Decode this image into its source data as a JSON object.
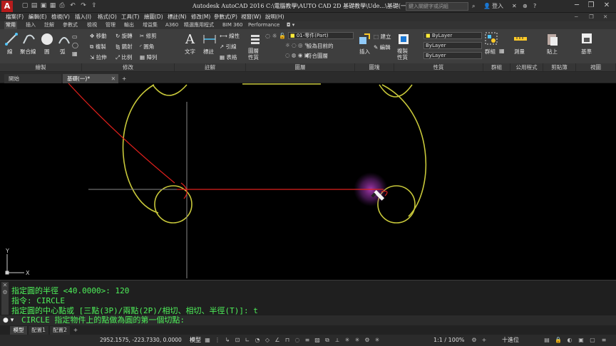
{
  "title_bar": {
    "title": "Autodesk AutoCAD 2016    C:\\電腦教學\\AUTO CAD 2D 基礎教學\\Ude...\\基礎(一).dwg",
    "search_placeholder": "鍵入關鍵字或詞組",
    "signin": "登入",
    "icons": [
      "app-logo",
      "new",
      "open",
      "save",
      "saveas",
      "print",
      "undo",
      "redo",
      "share"
    ]
  },
  "menu": [
    "檔案(F)",
    "編輯(E)",
    "檢視(V)",
    "插入(I)",
    "格式(O)",
    "工具(T)",
    "繪圖(D)",
    "標註(N)",
    "修改(M)",
    "參數式(P)",
    "視窗(W)",
    "說明(H)"
  ],
  "ribbon_tabs": [
    "常用",
    "插入",
    "註解",
    "參數式",
    "檢視",
    "管理",
    "輸出",
    "增益集",
    "A360",
    "精選應用程式",
    "BIM 360",
    "Performance"
  ],
  "ribbon": {
    "draw": {
      "footer": "繪製",
      "line": "線",
      "polyline": "聚合線",
      "circle": "圓",
      "arc": "弧"
    },
    "modify": {
      "footer": "修改",
      "move": "移動",
      "rotate": "旋轉",
      "trim": "修剪",
      "copy": "複製",
      "mirror": "鏡射",
      "fillet": "圓角",
      "stretch": "拉伸",
      "scale": "比例",
      "array": "陣列"
    },
    "annotation": {
      "footer": "註解",
      "text": "文字",
      "dimension": "標註",
      "leader": "引線",
      "table": "表格",
      "linear": "線性"
    },
    "layers": {
      "footer": "圖層",
      "properties": "圖層\n性質",
      "current_layer": "01-零件(Part)",
      "make_current": "設為目前的",
      "match": "符合圖層"
    },
    "block": {
      "footer": "圖塊",
      "insert": "插入",
      "create": "建立",
      "edit": "編輯"
    },
    "properties": {
      "footer": "性質",
      "match": "複製\n性質",
      "color": "ByLayer",
      "linetype": "ByLayer",
      "lineweight": "ByLayer"
    },
    "groups": {
      "footer": "群組",
      "group": "群組"
    },
    "utilities": {
      "footer": "公用程式",
      "measure": "測量"
    },
    "clipboard": {
      "footer": "剪貼簿",
      "paste": "貼上"
    },
    "view": {
      "footer": "視圖",
      "base": "基準"
    }
  },
  "file_tabs": [
    "開始",
    "基礎(一)*"
  ],
  "command_history": [
    "指定圓的半徑 <40.0000>: 120",
    "指令:  CIRCLE",
    "指定圓的中心點或 [三點(3P)/兩點(2P)/相切、相切、半徑(T)]: t"
  ],
  "command_line": "CIRCLE 指定物件上的點做為圓的第一個切點:",
  "layout_tabs": [
    "模型",
    "配置1",
    "配置2"
  ],
  "status": {
    "coords": "2952.1575, -223.7330, 0.0000",
    "model": "模型",
    "scale": "1:1 / 100%",
    "units": "十進位"
  },
  "ucs": {
    "x": "X",
    "y": "Y"
  },
  "colors": {
    "geometry": "#c8c83a",
    "rubberband": "#e0201c",
    "crosshair": "#8a8a8a",
    "command_text": "#4ef05a"
  }
}
